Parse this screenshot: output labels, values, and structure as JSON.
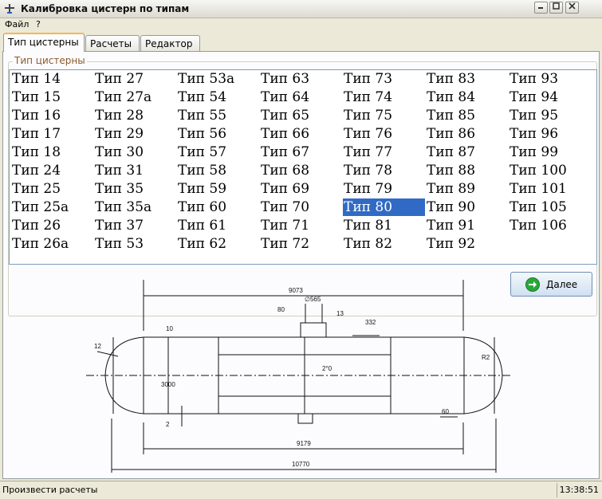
{
  "window": {
    "title": "Калибровка цистерн по типам"
  },
  "menu": {
    "file": "Файл",
    "help": "?"
  },
  "tabs": [
    {
      "label": "Тип цистерны",
      "active": true
    },
    {
      "label": "Расчеты",
      "active": false
    },
    {
      "label": "Редактор",
      "active": false
    }
  ],
  "group": {
    "legend": "Тип цистерны"
  },
  "types": {
    "columns": [
      [
        "Тип 14",
        "Тип 15",
        "Тип 16",
        "Тип 17",
        "Тип 18",
        "Тип 24",
        "Тип 25",
        "Тип 25а",
        "Тип 26",
        "Тип 26а"
      ],
      [
        "Тип 27",
        "Тип 27а",
        "Тип 28",
        "Тип 29",
        "Тип 30",
        "Тип 31",
        "Тип 35",
        "Тип 35а",
        "Тип 37",
        "Тип 53"
      ],
      [
        "Тип 53а",
        "Тип 54",
        "Тип 55",
        "Тип 56",
        "Тип 57",
        "Тип 58",
        "Тип 59",
        "Тип 60",
        "Тип 61",
        "Тип 62"
      ],
      [
        "Тип 63",
        "Тип 64",
        "Тип 65",
        "Тип 66",
        "Тип 67",
        "Тип 68",
        "Тип 69",
        "Тип 70",
        "Тип 71",
        "Тип 72"
      ],
      [
        "Тип 73",
        "Тип 74",
        "Тип 75",
        "Тип 76",
        "Тип 77",
        "Тип 78",
        "Тип 79",
        "Тип 80",
        "Тип 81",
        "Тип 82"
      ],
      [
        "Тип 83",
        "Тип 84",
        "Тип 85",
        "Тип 86",
        "Тип 87",
        "Тип 88",
        "Тип 89",
        "Тип 90",
        "Тип 91",
        "Тип 92"
      ],
      [
        "Тип 93",
        "Тип 94",
        "Тип 95",
        "Тип 96",
        "Тип 99",
        "Тип 100",
        "Тип 101",
        "Тип 105",
        "Тип 106"
      ]
    ],
    "selected": "Тип 80"
  },
  "next_button": {
    "label": "Далее"
  },
  "drawing": {
    "dims": {
      "top_length": "9073",
      "hatch_dia": "∅565",
      "d80": "80",
      "d13": "13",
      "d332": "332",
      "d10": "10",
      "d3000": "3000",
      "d2": "2",
      "d2_0": "2°0",
      "d12": "12",
      "d60": "60",
      "r": "R2",
      "mid_length": "9179",
      "total_length": "10770"
    }
  },
  "status": {
    "text": "Произвести расчеты",
    "time": "13:38:51"
  },
  "colors": {
    "selection": "#316ac5",
    "accent": "#f6b74e"
  }
}
